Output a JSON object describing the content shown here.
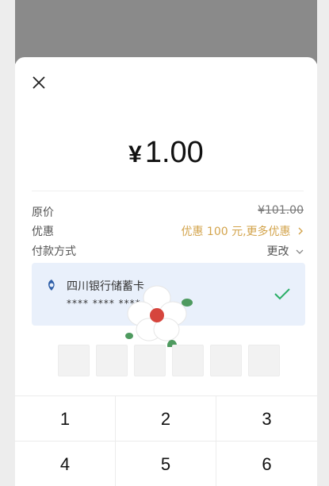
{
  "payment": {
    "amount": "1.00",
    "currency_symbol": "¥"
  },
  "details": {
    "original_price_label": "原价",
    "original_price_value": "¥101.00",
    "discount_label": "优惠",
    "discount_value": "优惠 100 元,更多优惠",
    "payment_method_label": "付款方式",
    "change_label": "更改"
  },
  "card": {
    "bank_name": "四川银行储蓄卡",
    "masked_number": "**** **** ****",
    "selected": true
  },
  "pin": {
    "digits_entered": 0,
    "boxes": 6
  },
  "keypad": {
    "keys": [
      "1",
      "2",
      "3",
      "4",
      "5",
      "6"
    ]
  },
  "icons": {
    "close": "close-icon",
    "check": "check-icon",
    "chevron_right": "chevron-right-icon",
    "chevron_down": "chevron-down-icon",
    "bank_logo": "bank-logo-icon"
  },
  "colors": {
    "promo": "#d3a44d",
    "check": "#2aae67",
    "card_bg": "#e9f0fb"
  }
}
